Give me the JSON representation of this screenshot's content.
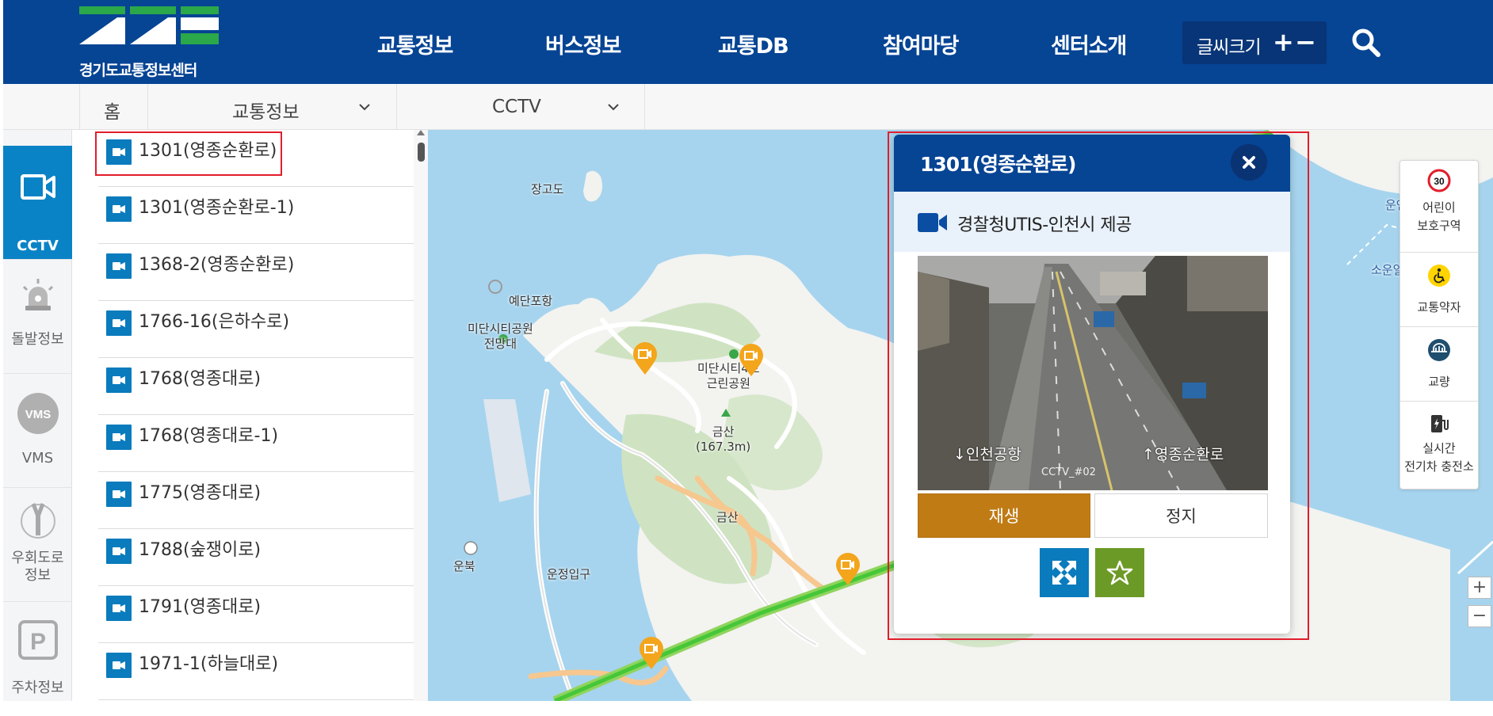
{
  "header": {
    "logo_text": "경기도교통정보센터",
    "nav": [
      "교통정보",
      "버스정보",
      "교통DB",
      "참여마당",
      "센터소개"
    ],
    "font_size_label": "글씨크기",
    "font_plus": "+",
    "font_minus": "−",
    "search_icon": "search-icon"
  },
  "breadcrumb": {
    "home": "홈",
    "level1": "교통정보",
    "level2": "CCTV"
  },
  "rail": [
    {
      "label": "CCTV",
      "icon": "cctv-camera-icon",
      "active": true
    },
    {
      "label": "돌발정보",
      "icon": "siren-icon",
      "active": false
    },
    {
      "label": "VMS",
      "icon": "vms-icon",
      "active": false
    },
    {
      "label": "우회도로\n정보",
      "icon": "detour-road-icon",
      "active": false
    },
    {
      "label": "주차정보",
      "icon": "parking-icon",
      "active": false
    }
  ],
  "cctv_list": [
    "1301(영종순환로)",
    "1301(영종순환로-1)",
    "1368-2(영종순환로)",
    "1766-16(은하수로)",
    "1768(영종대로)",
    "1768(영종대로-1)",
    "1775(영종대로)",
    "1788(숲쟁이로)",
    "1791(영종대로)",
    "1971-1(하늘대로)"
  ],
  "map": {
    "labels": {
      "janggodo": "장고도",
      "yedanpo": "예단포항",
      "midan_park": "미단시티공원\n전망대",
      "midan_4ho": "미단시티4호\n근린공원",
      "geumsan": "금산\n(167.3m)",
      "geumsan2": "금산",
      "unbuk": "운북",
      "ipgu": "운정입구",
      "right1": "운연",
      "right2": "소운일"
    }
  },
  "popup": {
    "title": "1301(영종순환로)",
    "source": "경찰청UTIS-인천시 제공",
    "video_left_caption": "↓인천공항",
    "video_right_caption": "↑영종순환로",
    "video_id": "CCTV_#02",
    "play_label": "재생",
    "stop_label": "정지"
  },
  "layers": [
    {
      "label": "어린이\n보호구역",
      "icon": "speed-limit-30-icon",
      "badge": "30"
    },
    {
      "label": "교통약자",
      "icon": "wheelchair-icon"
    },
    {
      "label": "교량",
      "icon": "bridge-icon"
    },
    {
      "label": "실시간\n전기차 충전소",
      "icon": "ev-charger-icon"
    }
  ],
  "zoom": {
    "in": "+",
    "out": "−"
  },
  "colors": {
    "header_bg": "#064494",
    "active_blue": "#0a83c6",
    "play_orange": "#c07b15",
    "favorite_green": "#6c9a26",
    "highlight_red": "#e21d2b"
  }
}
